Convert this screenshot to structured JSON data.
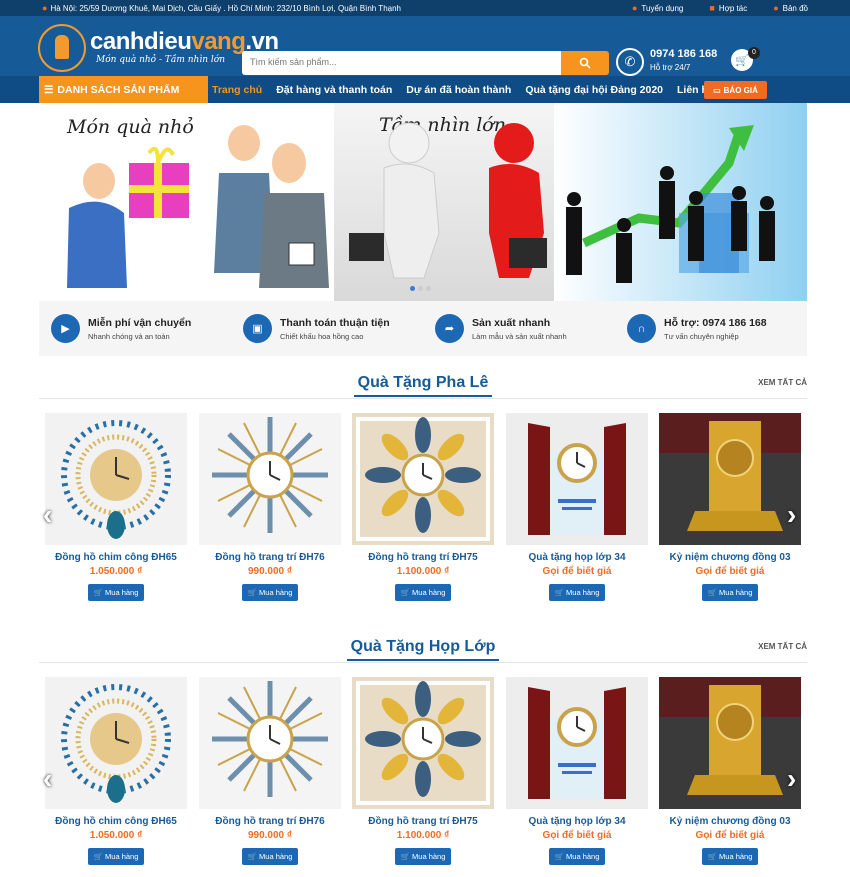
{
  "topbar": {
    "address": "Hà Nội: 25/59 Dương Khuê, Mai Dịch, Cầu Giấy . Hồ Chí Minh: 232/10 Bình Lợi, Quận Bình Thạnh",
    "links": [
      "Tuyển dụng",
      "Hợp tác",
      "Bản đồ"
    ]
  },
  "header": {
    "brand_main": "canhdieu",
    "brand_accent": "vang",
    "brand_tld": ".vn",
    "slogan": "Món quà nhỏ - Tầm nhìn lớn",
    "search_placeholder": "Tìm kiếm sản phẩm...",
    "hotline": "0974 186 168",
    "hotline_sub": "Hỗ trợ 24/7",
    "cart_count": "0"
  },
  "nav": {
    "category_label": "DANH SÁCH SẢN PHẨM",
    "items": [
      "Trang chủ",
      "Đặt hàng và thanh toán",
      "Dự án đã hoàn thành",
      "Quà tặng đại hội Đảng 2020",
      "Liên hệ"
    ],
    "quote_label": "BÁO GIÁ"
  },
  "banner": {
    "caption_left": "Món quà nhỏ",
    "caption_right": "Tầm nhìn lớn"
  },
  "features": [
    {
      "icon": "truck-icon",
      "title": "Miễn phí vận chuyển",
      "sub": "Nhanh chóng và an toàn"
    },
    {
      "icon": "money-icon",
      "title": "Thanh toán thuận tiện",
      "sub": "Chiết khấu hoa hồng cao"
    },
    {
      "icon": "share-icon",
      "title": "Sản xuất nhanh",
      "sub": "Làm mẫu và sản xuất nhanh"
    },
    {
      "icon": "headset-icon",
      "title": "Hỗ trợ: 0974 186 168",
      "sub": "Tư vấn chuyên nghiệp"
    }
  ],
  "sections": [
    {
      "title": "Quà Tặng Pha Lê",
      "view_all": "XEM TẤT CẢ",
      "products": [
        {
          "name": "Đồng hồ chim công ĐH65",
          "price": "1.050.000 ₫",
          "buy": "Mua hàng"
        },
        {
          "name": "Đồng hồ trang trí ĐH76",
          "price": "990.000 ₫",
          "buy": "Mua hàng"
        },
        {
          "name": "Đồng hồ trang trí ĐH75",
          "price": "1.100.000 ₫",
          "buy": "Mua hàng"
        },
        {
          "name": "Quà tặng họp lớp 34",
          "price": "Gọi để biết giá",
          "buy": "Mua hàng"
        },
        {
          "name": "Kỷ niệm chương đồng 03",
          "price": "Gọi để biết giá",
          "buy": "Mua hàng"
        }
      ]
    },
    {
      "title": "Quà Tặng Họp Lớp",
      "view_all": "XEM TẤT CẢ",
      "products": [
        {
          "name": "Đồng hồ chim công ĐH65",
          "price": "1.050.000 ₫",
          "buy": "Mua hàng"
        },
        {
          "name": "Đồng hồ trang trí ĐH76",
          "price": "990.000 ₫",
          "buy": "Mua hàng"
        },
        {
          "name": "Đồng hồ trang trí ĐH75",
          "price": "1.100.000 ₫",
          "buy": "Mua hàng"
        },
        {
          "name": "Quà tặng họp lớp 34",
          "price": "Gọi để biết giá",
          "buy": "Mua hàng"
        },
        {
          "name": "Kỷ niệm chương đồng 03",
          "price": "Gọi để biết giá",
          "buy": "Mua hàng"
        }
      ]
    }
  ]
}
